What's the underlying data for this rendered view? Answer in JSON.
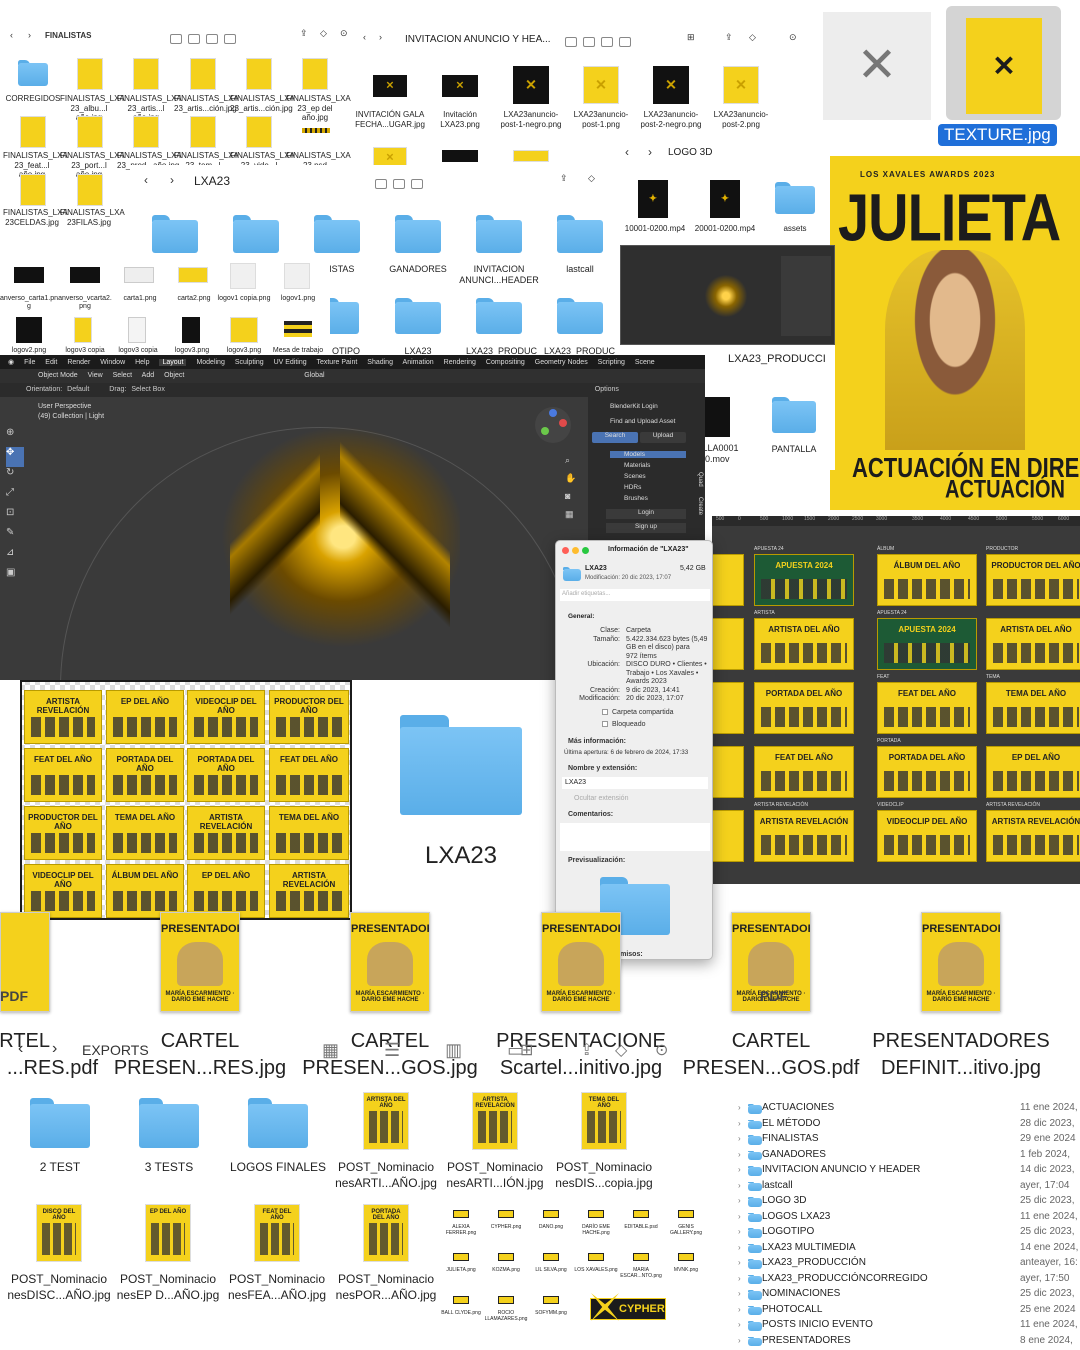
{
  "finder_finalistas": {
    "title": "FINALISTAS",
    "items": [
      "CORREGIDOS",
      "FINALISTAS_LXA 23_albu...l año.jpg",
      "FINALISTAS_LXA 23_artis...l año.jpg",
      "FINALISTAS_LXA 23_artis...ción.jpg",
      "FINALISTAS_LXA 23_artis...ción.jpg",
      "FINALISTAS_LXA 23_ep del año.jpg",
      "FINALISTAS_LXA 23_feat...l año.jpg",
      "FINALISTAS_LXA 23_port...l año.jpg",
      "FINALISTAS_LXA 23_prod...año.jpg",
      "FINALISTAS_LXA 23_tem...l año.jpg",
      "FINALISTAS_LXA 23_vide...l año.jpg",
      "FINALISTAS_LXA 23.psd",
      "FINALISTAS_LXA 23CELDAS.jpg",
      "FINALISTAS_LXA 23FILAS.jpg"
    ]
  },
  "finder_invitacion": {
    "title": "INVITACION ANUNCIO Y HEA...",
    "items": [
      "INVITACIÓN GALA FECHA...UGAR.jpg",
      "Invitación LXA23.png",
      "LXA23anuncio-post-1-negro.png",
      "LXA23anuncio-post-1.png",
      "LXA23anuncio-post-2-negro.png",
      "LXA23anuncio-post-2.png",
      "LXA23carta-1.png",
      "LXA23header-1-negro.png",
      "LXA23header-1.png"
    ]
  },
  "texture": {
    "label": "TEXTURE.jpg"
  },
  "logo3d": {
    "title": "LOGO 3D",
    "items": [
      "10001-0200.mp4",
      "20001-0200.mp4",
      "assets"
    ]
  },
  "poster": {
    "header": "LOS XAVALES AWARDS 2023",
    "name": "JULIETA",
    "footer": "ACTUACIÓN EN DIRECTO",
    "footer2": "ACTUACIÓN"
  },
  "finder_lxa23": {
    "title": "LXA23",
    "items": [
      ".LISTAS",
      "GANADORES",
      "INVITACION ANUNCI...HEADER",
      "lastcall",
      "OTIPO",
      "LXA23",
      "LXA23_PRODUC",
      "LXA23_PRODUC"
    ]
  },
  "finder_cartas": {
    "items": [
      "anverso_carta1.pn g",
      "anverso_vcarta2. png",
      "carta1.png",
      "carta2.png",
      "logov1 copia.png",
      "logov1.png",
      "logov2.png",
      "logov3 copia",
      "logov3 copia",
      "logov3.png",
      "logov3.png",
      "Mesa de trabajo"
    ]
  },
  "produccion": {
    "title": "LXA23_PRODUCCI",
    "items": [
      "ILLA0001 50.mov",
      "PANTALLA"
    ]
  },
  "blender": {
    "menu": [
      "File",
      "Edit",
      "Render",
      "Window",
      "Help"
    ],
    "workspaces": [
      "Layout",
      "Modeling",
      "Sculpting",
      "UV Editing",
      "Texture Paint",
      "Shading",
      "Animation",
      "Rendering",
      "Compositing",
      "Geometry Nodes",
      "Scripting"
    ],
    "scene": "Scene",
    "mode": "Object Mode",
    "header_items": [
      "View",
      "Select",
      "Add",
      "Object"
    ],
    "orientation_label": "Orientation:",
    "orientation": "Default",
    "drag_label": "Drag:",
    "drag": "Select Box",
    "transform": "Global",
    "options": "Options",
    "viewport_title": "User Perspective",
    "viewport_sub": "(49) Collection | Light",
    "panel_items": [
      "BlenderKit Login",
      "Find and Upload Asset",
      "Search",
      "Upload",
      "Models",
      "Materials",
      "Scenes",
      "HDRs",
      "Brushes",
      "Login",
      "Sign up"
    ],
    "side_tabs": [
      "Item",
      "Tool",
      "View",
      "Create",
      "Quad",
      "BlenderKit"
    ]
  },
  "info_window": {
    "title": "Información de \"LXA23\"",
    "name": "LXA23",
    "size": "5,42 GB",
    "modified_short": "Modificación: 20 dic 2023, 17:07",
    "tags_placeholder": "Añadir etiquetas...",
    "general_label": "General:",
    "rows": [
      {
        "k": "Clase:",
        "v": "Carpeta"
      },
      {
        "k": "Tamaño:",
        "v": "5.422.334.623 bytes (5,49"
      },
      {
        "k": "",
        "v": "GB en el disco) para"
      },
      {
        "k": "",
        "v": "972 ítems"
      },
      {
        "k": "Ubicación:",
        "v": "DISCO DURO • Clientes •"
      },
      {
        "k": "",
        "v": "Trabajo • Los Xavales •"
      },
      {
        "k": "",
        "v": "Awards 2023"
      },
      {
        "k": "Creación:",
        "v": "9 dic 2023, 14:41"
      },
      {
        "k": "Modificación:",
        "v": "20 dic 2023, 17:07"
      }
    ],
    "shared": "Carpeta compartida",
    "locked": "Bloqueado",
    "more_info": "Más información:",
    "last_open": "Última apertura: 6 de febrero de 2024, 17:33",
    "name_ext": "Nombre y extensión:",
    "name_value": "LXA23",
    "hide_ext": "Ocultar extensión",
    "comments": "Comentarios:",
    "preview": "Previsualización:",
    "share": "Compartir y permisos:"
  },
  "lxa23_folder": {
    "label": "LXA23"
  },
  "grid_left": [
    "ARTISTA REVELACIÓN",
    "EP DEL AÑO",
    "VIDEOCLIP DEL AÑO",
    "PRODUCTOR DEL AÑO",
    "FEAT DEL AÑO",
    "PORTADA DEL AÑO",
    "PORTADA DEL AÑO",
    "FEAT DEL AÑO",
    "PRODUCTOR DEL AÑO",
    "TEMA DEL AÑO",
    "ARTISTA REVELACIÓN",
    "TEMA DEL AÑO",
    "VIDEOCLIP DEL AÑO",
    "ÁLBUM DEL AÑO",
    "EP DEL AÑO",
    "ARTISTA REVELACIÓN"
  ],
  "design_canvas": {
    "ruler": [
      "500",
      "0",
      "500",
      "1000",
      "1500",
      "2000",
      "2500",
      "3000",
      "3500",
      "4000",
      "4500",
      "5000",
      "5500",
      "6000"
    ],
    "col_labels": [
      "APUESTA 24",
      "ÁLBUM",
      "PRODUCTOR"
    ],
    "tiles": [
      "APUESTA 2024",
      "ÁLBUM DEL AÑO",
      "PRODUCTOR DEL AÑO",
      "ARTISTA DEL AÑO",
      "APUESTA 2024",
      "ARTISTA DEL AÑO",
      "PORTADA DEL AÑO",
      "FEAT DEL AÑO",
      "TEMA DEL AÑO",
      "FEAT DEL AÑO",
      "PORTADA DEL AÑO",
      "EP DEL AÑO",
      "ARTISTA REVELACIÓN",
      "VIDEOCLIP DEL AÑO",
      "ARTISTA REVELACIÓN"
    ],
    "row_labels": [
      "ARTISTA",
      "APUESTA 24",
      "FEAT",
      "TEMA",
      "PORTADA",
      "VIDEOCLIP",
      "ARTISTA REVELACIÓN",
      "PORTADA",
      "EP",
      "VIDEOCLIP"
    ]
  },
  "presentadores": {
    "poster_title": "PRESENTADORES",
    "poster_names": "MARÍA ESCARMIENTO · DARÍO EME HACHE",
    "badges": [
      "PDF",
      "PDF"
    ],
    "labels": [
      [
        "RTEL",
        "...RES.pdf"
      ],
      [
        "CARTEL",
        "PRESEN...RES.jpg"
      ],
      [
        "CARTEL",
        "PRESEN...GOS.jpg"
      ],
      [
        "PRESENTACIONE",
        "Scartel...initivo.jpg"
      ],
      [
        "CARTEL",
        "PRESEN...GOS.pdf"
      ],
      [
        "PRESENTADORES",
        "DEFINIT...itivo.jpg"
      ]
    ]
  },
  "finder_exports": {
    "title": "EXPORTS",
    "folders": [
      "2 TEST",
      "3 TESTS",
      "LOGOS FINALES"
    ],
    "files": [
      {
        "title": "ARTISTA DEL AÑO",
        "label1": "POST_Nominacio",
        "label2": "nesARTI...AÑO.jpg"
      },
      {
        "title": "ARTISTA REVELACIÓN",
        "label1": "POST_Nominacio",
        "label2": "nesARTI...IÓN.jpg"
      },
      {
        "title": "TEMA DEL AÑO",
        "label1": "POST_Nominacio",
        "label2": "nesDIS...copia.jpg"
      },
      {
        "title": "DISCO DEL AÑO",
        "label1": "POST_Nominacio",
        "label2": "nesDISC...AÑO.jpg"
      },
      {
        "title": "EP DEL AÑO",
        "label1": "POST_Nominacio",
        "label2": "nesEP D...AÑO.jpg"
      },
      {
        "title": "FEAT DEL AÑO",
        "label1": "POST_Nominacio",
        "label2": "nesFEA...AÑO.jpg"
      },
      {
        "title": "PORTADA DEL AÑO",
        "label1": "POST_Nominacio",
        "label2": "nesPOR...AÑO.jpg"
      }
    ]
  },
  "small_logos": {
    "items": [
      "ALEXIA FERRER.png",
      "CYPHER.png",
      "DANO.png",
      "DARÍO EME HACHE.png",
      "EDITABLE.psd",
      "GENIS GALLERY.png",
      "JULIETA.png",
      "KOZMA.png",
      "LIL SILVA.png",
      "LOS XAVALES.png",
      "MARIA ESCAR...NTO.png",
      "MVNK.png",
      "BALL CLYDE.png",
      "ROCIO LLAMAZARES.png",
      "SOFYMM.png"
    ],
    "cypher": "CYPHER"
  },
  "folder_list": [
    {
      "name": "ACTUACIONES",
      "date": "11 ene 2024,"
    },
    {
      "name": "EL MÉTODO",
      "date": "28 dic 2023,"
    },
    {
      "name": "FINALISTAS",
      "date": "29 ene 2024"
    },
    {
      "name": "GANADORES",
      "date": "1 feb 2024,"
    },
    {
      "name": "INVITACION ANUNCIO Y HEADER",
      "date": "14 dic 2023,"
    },
    {
      "name": "lastcall",
      "date": "ayer, 17:04"
    },
    {
      "name": "LOGO 3D",
      "date": "25 dic 2023,"
    },
    {
      "name": "LOGOS LXA23",
      "date": "11 ene 2024,"
    },
    {
      "name": "LOGOTIPO",
      "date": "25 dic 2023,"
    },
    {
      "name": "LXA23 MULTIMEDIA",
      "date": "14 ene 2024,"
    },
    {
      "name": "LXA23_PRODUCCIÓN",
      "date": "anteayer, 16:"
    },
    {
      "name": "LXA23_PRODUCCIÓNCORREGIDO",
      "date": "ayer, 17:50"
    },
    {
      "name": "NOMINACIONES",
      "date": "25 dic 2023,"
    },
    {
      "name": "PHOTOCALL",
      "date": "25 ene 2024"
    },
    {
      "name": "POSTS INICIO EVENTO",
      "date": "11 ene 2024,"
    },
    {
      "name": "PRESENTADORES",
      "date": "8 ene 2024,"
    }
  ],
  "colors": {
    "yellow": "#f4d11c",
    "folder": "#6ab8ef",
    "dark": "#2b2b2b",
    "green": "#1d5a35"
  }
}
